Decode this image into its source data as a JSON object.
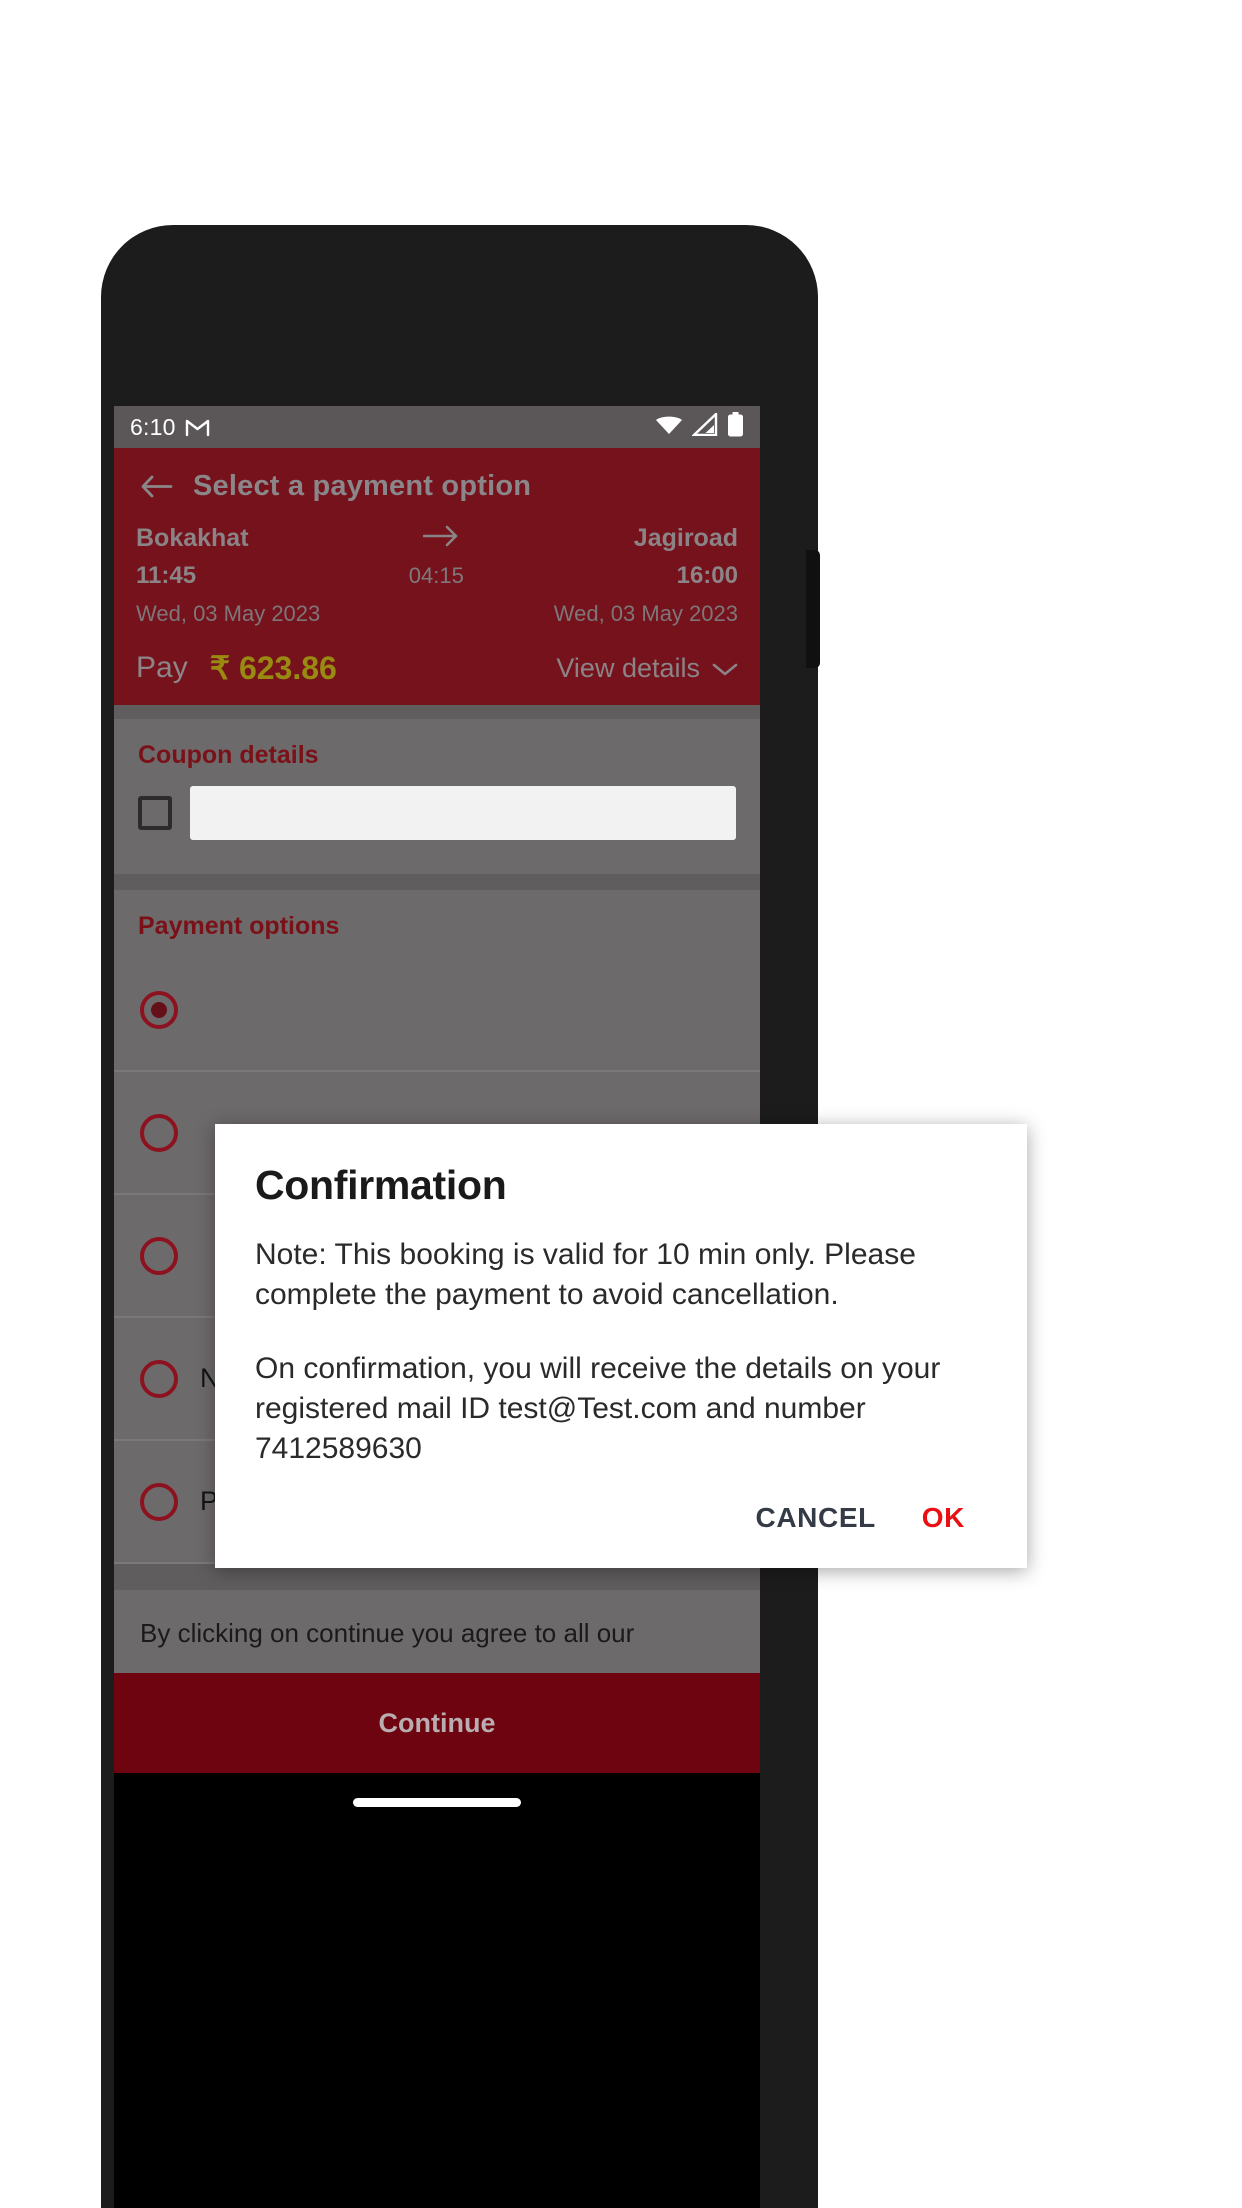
{
  "status_bar": {
    "time": "6:10",
    "app_icon": "gmail-m-icon",
    "icons": [
      "wifi-icon",
      "cellular-signal-icon",
      "battery-icon"
    ]
  },
  "header": {
    "back_icon": "back-arrow-icon",
    "title": "Select a payment option",
    "route": {
      "origin": "Bokakhat",
      "destination": "Jagiroad",
      "arrow_icon": "arrow-right-icon",
      "depart_time": "11:45",
      "duration": "04:15",
      "arrive_time": "16:00",
      "depart_date": "Wed, 03 May 2023",
      "arrive_date": "Wed, 03 May 2023"
    },
    "pay_label": "Pay",
    "pay_amount": "₹ 623.86",
    "view_details_label": "View details",
    "view_details_icon": "chevron-down-icon"
  },
  "coupon": {
    "section_title": "Coupon details",
    "checkbox_checked": false,
    "input_value": "",
    "input_placeholder": ""
  },
  "payment_options": {
    "section_title": "Payment options",
    "options": [
      {
        "label": "",
        "selected": true
      },
      {
        "label": "",
        "selected": false
      },
      {
        "label": "",
        "selected": false
      },
      {
        "label": "Net Banking",
        "selected": false
      },
      {
        "label": "Paytm Wallet",
        "selected": false
      }
    ]
  },
  "terms": {
    "text": "By clicking on continue you agree to all our"
  },
  "footer": {
    "continue_label": "Continue"
  },
  "dialog": {
    "title": "Confirmation",
    "paragraph_1": "Note: This booking is valid for 10 min only. Please complete the payment to avoid cancellation.",
    "paragraph_2": "On confirmation, you will receive the details on your registered mail ID test@Test.com and number 7412589630",
    "cancel_label": "CANCEL",
    "ok_label": "OK"
  },
  "colors": {
    "brand_maroon": "#7a1118",
    "header_maroon_dim": "#75121c",
    "continue_maroon": "#6e0410",
    "amount_gold": "#998a12",
    "ok_red": "#ea0f12",
    "cancel_grey": "#343a46",
    "scrim_grey": "#6d6a6b"
  }
}
